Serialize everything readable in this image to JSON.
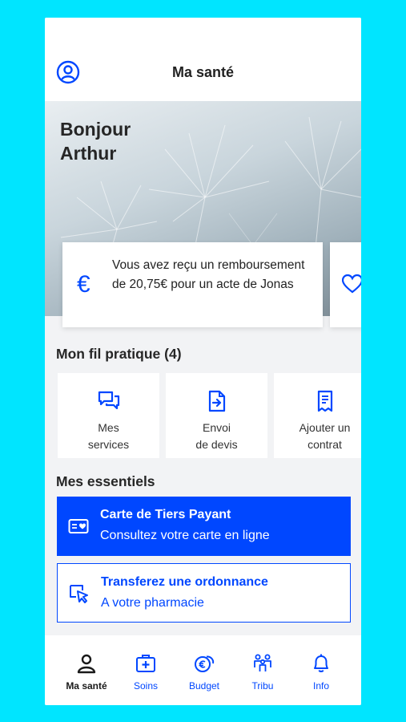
{
  "header": {
    "title": "Ma santé"
  },
  "hero": {
    "greeting_line1": "Bonjour",
    "greeting_line2": "Arthur"
  },
  "notification": {
    "icon": "euro-icon",
    "message": "Vous avez reçu un remboursement de 20,75€ pour un acte de Jonas"
  },
  "fil_pratique": {
    "title": "Mon fil pratique (4)",
    "tiles": [
      {
        "icon": "chat-icon",
        "label": "Mes\nservices"
      },
      {
        "icon": "document-upload-icon",
        "label": "Envoi\nde devis"
      },
      {
        "icon": "contract-icon",
        "label": "Ajouter un\ncontrat"
      }
    ]
  },
  "essentiels": {
    "title": "Mes essentiels",
    "cards": [
      {
        "icon": "card-icon",
        "title": "Carte de Tiers Payant",
        "subtitle": "Consultez votre carte en ligne"
      },
      {
        "icon": "prescription-icon",
        "title": "Transferez une ordonnance",
        "subtitle": "A votre pharmacie"
      }
    ]
  },
  "tabbar": {
    "items": [
      {
        "label": "Ma santé",
        "icon": "person-icon",
        "active": true
      },
      {
        "label": "Soins",
        "icon": "medical-bag-icon",
        "active": false
      },
      {
        "label": "Budget",
        "icon": "coins-icon",
        "active": false
      },
      {
        "label": "Tribu",
        "icon": "family-icon",
        "active": false
      },
      {
        "label": "Info",
        "icon": "bell-icon",
        "active": false
      }
    ]
  },
  "colors": {
    "accent": "#0047ff",
    "background": "#00e5ff",
    "text": "#262626"
  }
}
